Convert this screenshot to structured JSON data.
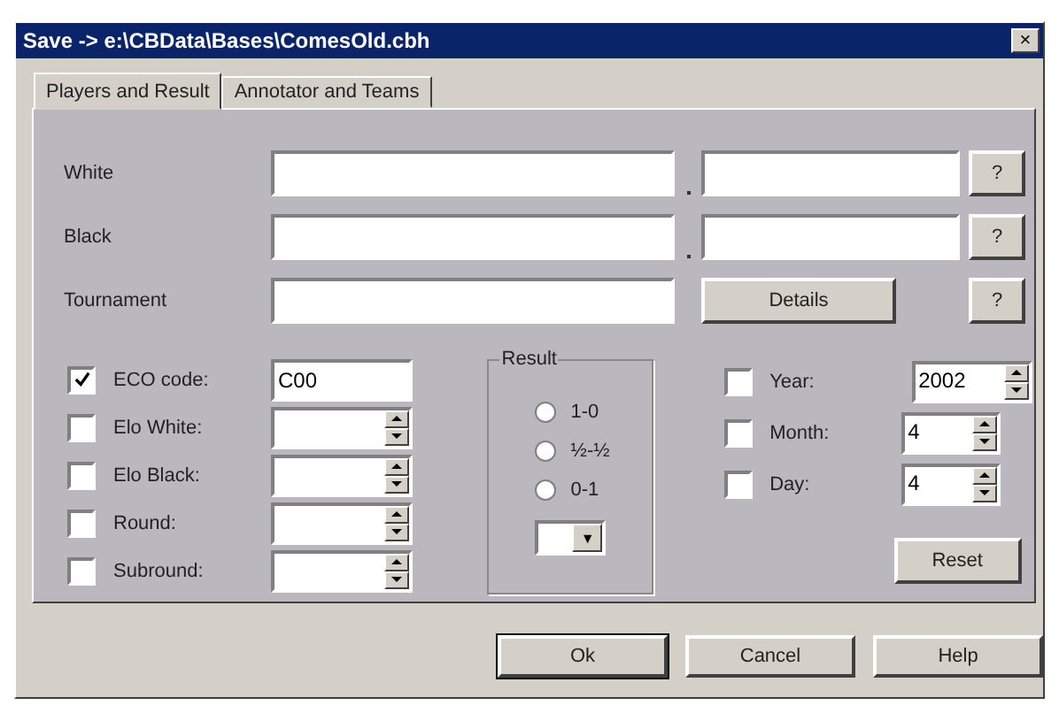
{
  "window": {
    "title": "Save -> e:\\CBData\\Bases\\ComesOld.cbh",
    "close": "×"
  },
  "tabs": [
    {
      "label": "Players and Result",
      "selected": true
    },
    {
      "label": "Annotator and Teams",
      "selected": false
    }
  ],
  "players": [
    {
      "label": "White",
      "help": "?"
    },
    {
      "label": "Black",
      "help": "?"
    }
  ],
  "tournament": {
    "label": "Tournament",
    "details": "Details",
    "help": "?"
  },
  "options": [
    {
      "label": "ECO code:",
      "checked": true,
      "kind": "text",
      "value": "C00"
    },
    {
      "label": "Elo White:",
      "checked": false,
      "kind": "spin"
    },
    {
      "label": "Elo Black:",
      "checked": false,
      "kind": "spin"
    },
    {
      "label": "Round:",
      "checked": false,
      "kind": "spin"
    },
    {
      "label": "Subround:",
      "checked": false,
      "kind": "spin"
    }
  ],
  "result": {
    "title": "Result",
    "choices": [
      {
        "label": "1-0",
        "selected": false
      },
      {
        "label": "½-½",
        "selected": false
      },
      {
        "label": "0-1",
        "selected": false
      }
    ],
    "dropdown": "▼"
  },
  "date": [
    {
      "label": "Year:",
      "checked": false,
      "value": "2002"
    },
    {
      "label": "Month:",
      "checked": false,
      "value": "4"
    },
    {
      "label": "Day:",
      "checked": false,
      "value": "4"
    }
  ],
  "reset": "Reset",
  "buttons": [
    {
      "label": "Ok",
      "default": true
    },
    {
      "label": "Cancel",
      "default": false
    },
    {
      "label": "Help",
      "default": false
    }
  ]
}
